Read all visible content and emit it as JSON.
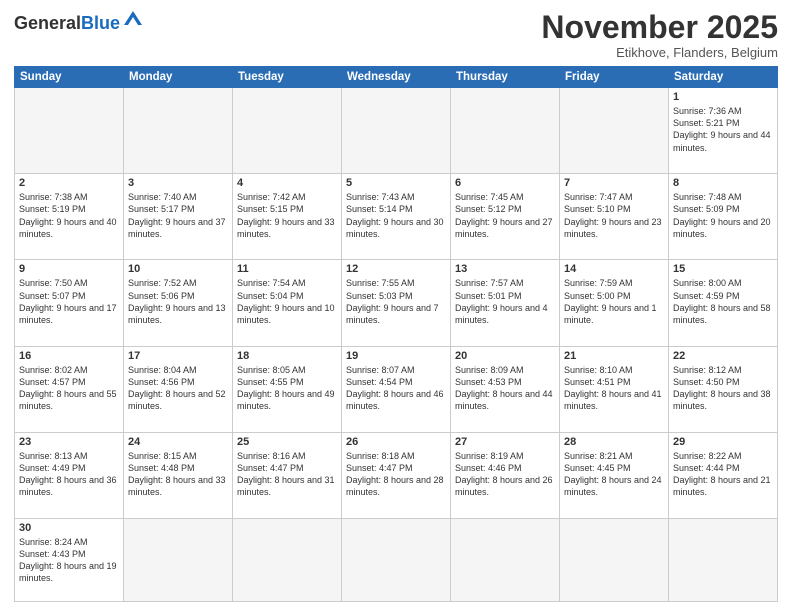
{
  "logo": {
    "text_general": "General",
    "text_blue": "Blue"
  },
  "header": {
    "title": "November 2025",
    "subtitle": "Etikhove, Flanders, Belgium"
  },
  "weekdays": [
    "Sunday",
    "Monday",
    "Tuesday",
    "Wednesday",
    "Thursday",
    "Friday",
    "Saturday"
  ],
  "weeks": [
    [
      {
        "day": "",
        "info": ""
      },
      {
        "day": "",
        "info": ""
      },
      {
        "day": "",
        "info": ""
      },
      {
        "day": "",
        "info": ""
      },
      {
        "day": "",
        "info": ""
      },
      {
        "day": "",
        "info": ""
      },
      {
        "day": "1",
        "info": "Sunrise: 7:36 AM\nSunset: 5:21 PM\nDaylight: 9 hours\nand 44 minutes."
      }
    ],
    [
      {
        "day": "2",
        "info": "Sunrise: 7:38 AM\nSunset: 5:19 PM\nDaylight: 9 hours\nand 40 minutes."
      },
      {
        "day": "3",
        "info": "Sunrise: 7:40 AM\nSunset: 5:17 PM\nDaylight: 9 hours\nand 37 minutes."
      },
      {
        "day": "4",
        "info": "Sunrise: 7:42 AM\nSunset: 5:15 PM\nDaylight: 9 hours\nand 33 minutes."
      },
      {
        "day": "5",
        "info": "Sunrise: 7:43 AM\nSunset: 5:14 PM\nDaylight: 9 hours\nand 30 minutes."
      },
      {
        "day": "6",
        "info": "Sunrise: 7:45 AM\nSunset: 5:12 PM\nDaylight: 9 hours\nand 27 minutes."
      },
      {
        "day": "7",
        "info": "Sunrise: 7:47 AM\nSunset: 5:10 PM\nDaylight: 9 hours\nand 23 minutes."
      },
      {
        "day": "8",
        "info": "Sunrise: 7:48 AM\nSunset: 5:09 PM\nDaylight: 9 hours\nand 20 minutes."
      }
    ],
    [
      {
        "day": "9",
        "info": "Sunrise: 7:50 AM\nSunset: 5:07 PM\nDaylight: 9 hours\nand 17 minutes."
      },
      {
        "day": "10",
        "info": "Sunrise: 7:52 AM\nSunset: 5:06 PM\nDaylight: 9 hours\nand 13 minutes."
      },
      {
        "day": "11",
        "info": "Sunrise: 7:54 AM\nSunset: 5:04 PM\nDaylight: 9 hours\nand 10 minutes."
      },
      {
        "day": "12",
        "info": "Sunrise: 7:55 AM\nSunset: 5:03 PM\nDaylight: 9 hours\nand 7 minutes."
      },
      {
        "day": "13",
        "info": "Sunrise: 7:57 AM\nSunset: 5:01 PM\nDaylight: 9 hours\nand 4 minutes."
      },
      {
        "day": "14",
        "info": "Sunrise: 7:59 AM\nSunset: 5:00 PM\nDaylight: 9 hours\nand 1 minute."
      },
      {
        "day": "15",
        "info": "Sunrise: 8:00 AM\nSunset: 4:59 PM\nDaylight: 8 hours\nand 58 minutes."
      }
    ],
    [
      {
        "day": "16",
        "info": "Sunrise: 8:02 AM\nSunset: 4:57 PM\nDaylight: 8 hours\nand 55 minutes."
      },
      {
        "day": "17",
        "info": "Sunrise: 8:04 AM\nSunset: 4:56 PM\nDaylight: 8 hours\nand 52 minutes."
      },
      {
        "day": "18",
        "info": "Sunrise: 8:05 AM\nSunset: 4:55 PM\nDaylight: 8 hours\nand 49 minutes."
      },
      {
        "day": "19",
        "info": "Sunrise: 8:07 AM\nSunset: 4:54 PM\nDaylight: 8 hours\nand 46 minutes."
      },
      {
        "day": "20",
        "info": "Sunrise: 8:09 AM\nSunset: 4:53 PM\nDaylight: 8 hours\nand 44 minutes."
      },
      {
        "day": "21",
        "info": "Sunrise: 8:10 AM\nSunset: 4:51 PM\nDaylight: 8 hours\nand 41 minutes."
      },
      {
        "day": "22",
        "info": "Sunrise: 8:12 AM\nSunset: 4:50 PM\nDaylight: 8 hours\nand 38 minutes."
      }
    ],
    [
      {
        "day": "23",
        "info": "Sunrise: 8:13 AM\nSunset: 4:49 PM\nDaylight: 8 hours\nand 36 minutes."
      },
      {
        "day": "24",
        "info": "Sunrise: 8:15 AM\nSunset: 4:48 PM\nDaylight: 8 hours\nand 33 minutes."
      },
      {
        "day": "25",
        "info": "Sunrise: 8:16 AM\nSunset: 4:47 PM\nDaylight: 8 hours\nand 31 minutes."
      },
      {
        "day": "26",
        "info": "Sunrise: 8:18 AM\nSunset: 4:47 PM\nDaylight: 8 hours\nand 28 minutes."
      },
      {
        "day": "27",
        "info": "Sunrise: 8:19 AM\nSunset: 4:46 PM\nDaylight: 8 hours\nand 26 minutes."
      },
      {
        "day": "28",
        "info": "Sunrise: 8:21 AM\nSunset: 4:45 PM\nDaylight: 8 hours\nand 24 minutes."
      },
      {
        "day": "29",
        "info": "Sunrise: 8:22 AM\nSunset: 4:44 PM\nDaylight: 8 hours\nand 21 minutes."
      }
    ],
    [
      {
        "day": "30",
        "info": "Sunrise: 8:24 AM\nSunset: 4:43 PM\nDaylight: 8 hours\nand 19 minutes."
      },
      {
        "day": "",
        "info": ""
      },
      {
        "day": "",
        "info": ""
      },
      {
        "day": "",
        "info": ""
      },
      {
        "day": "",
        "info": ""
      },
      {
        "day": "",
        "info": ""
      },
      {
        "day": "",
        "info": ""
      }
    ]
  ]
}
